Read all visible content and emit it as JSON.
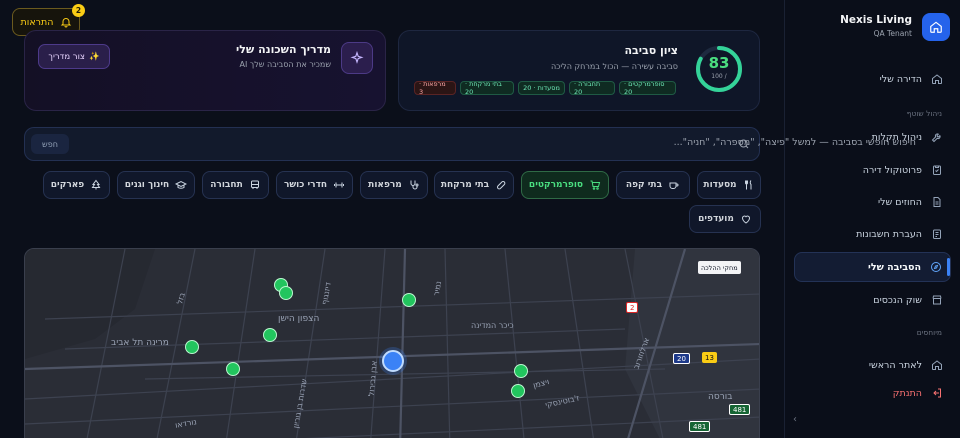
{
  "sidebar": {
    "brand_name": "Nexis Living",
    "brand_sub": "QA Tenant",
    "items_top": [
      {
        "label": "הדירה שלי",
        "icon": "home-icon"
      }
    ],
    "section_shared": "ניהול שוטף",
    "items_shared": [
      {
        "label": "ניהול תקלות",
        "icon": "wrench-icon"
      },
      {
        "label": "פרוטוקול דירה",
        "icon": "clipboard-icon"
      },
      {
        "label": "החוזים שלי",
        "icon": "file-icon"
      },
      {
        "label": "העברת חשבונות",
        "icon": "receipt-icon"
      },
      {
        "label": "הסביבה שלי",
        "icon": "compass-icon",
        "active": true
      },
      {
        "label": "שוק הנכסים",
        "icon": "store-icon"
      }
    ],
    "section_misc": "מיוחסים",
    "items_misc": [
      {
        "label": "לאתר הראשי",
        "icon": "home-icon"
      },
      {
        "label": "התנתק",
        "icon": "logout-icon"
      }
    ]
  },
  "topbar": {
    "notifications_label": "התראות",
    "notifications_count": "2"
  },
  "guide": {
    "title": "מדריך השכונה שלי",
    "subtitle": "AI שמכיר את הסביבה שלך",
    "button_label": "צור מדריך"
  },
  "score": {
    "value": "83",
    "max": "100 /",
    "fraction": 0.83,
    "title": "ציון סביבה",
    "subtitle": "סביבה עשירה — הכול במרחק הליכה",
    "chips": [
      {
        "label": "סופרמרקטים · 20",
        "tone": "green"
      },
      {
        "label": "תחבורה · 20",
        "tone": "green"
      },
      {
        "label": "מסעדות · 20",
        "tone": "green"
      },
      {
        "label": "בתי מרקחת · 20",
        "tone": "green"
      },
      {
        "label": "מרפאות · 3",
        "tone": "red"
      }
    ]
  },
  "search": {
    "placeholder": "חיפוש חופשי בסביבה — למשל \"פיצה\", \"מספרה\", \"חניה\"...",
    "button_label": "חפש"
  },
  "filters": [
    {
      "label": "מסעדות",
      "icon": "utensils-icon"
    },
    {
      "label": "בתי קפה",
      "icon": "coffee-icon"
    },
    {
      "label": "סופרמרקטים",
      "icon": "cart-icon",
      "active": true
    },
    {
      "label": "בתי מרקחת",
      "icon": "pill-icon"
    },
    {
      "label": "מרפאות",
      "icon": "stethoscope-icon"
    },
    {
      "label": "חדרי כושר",
      "icon": "dumbbell-icon"
    },
    {
      "label": "תחבורה",
      "icon": "bus-icon"
    },
    {
      "label": "חינוך וגנים",
      "icon": "graduation-icon"
    },
    {
      "label": "פארקים",
      "icon": "tree-icon"
    },
    {
      "label": "מועדפים",
      "icon": "heart-icon"
    }
  ],
  "map": {
    "tag": "מחקי ההלכה",
    "labels": [
      "הצפון הישן",
      "מרינה תל אביב",
      "כיכר המדינה",
      "בורסה",
      "ויצמן",
      "ז'בוטינסקי",
      "ארלוזורוב",
      "נורדאו",
      "שדרות בן גוריון",
      "אבן גבירול",
      "דיזנגוף",
      "נמיר",
      "בזל"
    ],
    "shields": [
      "2",
      "20",
      "13",
      "481",
      "481"
    ]
  }
}
